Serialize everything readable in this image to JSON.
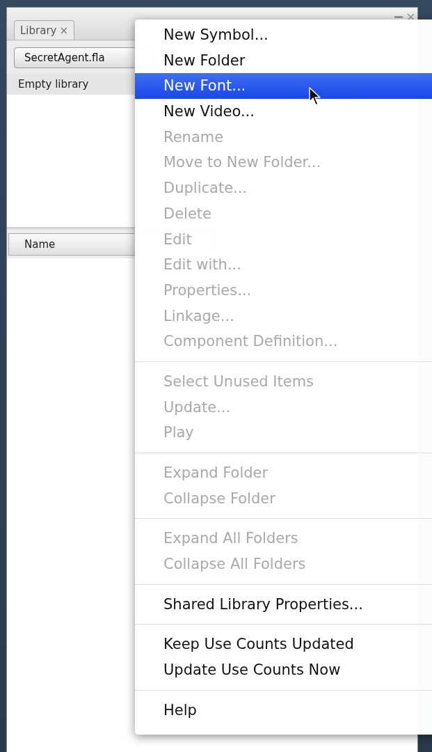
{
  "panel": {
    "tab": {
      "label": "Library",
      "close": "×",
      "selected": true
    },
    "document_dropdown": "SecretAgent.fla",
    "preview_caption": "Empty library",
    "list_columns": [
      "Name"
    ]
  },
  "context_menu": {
    "groups": [
      [
        {
          "label": "New Symbol...",
          "disabled": false,
          "selected": false
        },
        {
          "label": "New Folder",
          "disabled": false,
          "selected": false
        },
        {
          "label": "New Font...",
          "disabled": false,
          "selected": true
        },
        {
          "label": "New Video...",
          "disabled": false,
          "selected": false
        },
        {
          "label": "Rename",
          "disabled": true,
          "selected": false
        },
        {
          "label": "Move to New Folder...",
          "disabled": true,
          "selected": false
        },
        {
          "label": "Duplicate...",
          "disabled": true,
          "selected": false
        },
        {
          "label": "Delete",
          "disabled": true,
          "selected": false
        },
        {
          "label": "Edit",
          "disabled": true,
          "selected": false
        },
        {
          "label": "Edit with...",
          "disabled": true,
          "selected": false
        },
        {
          "label": "Properties...",
          "disabled": true,
          "selected": false
        },
        {
          "label": "Linkage...",
          "disabled": true,
          "selected": false
        },
        {
          "label": "Component Definition...",
          "disabled": true,
          "selected": false
        }
      ],
      [
        {
          "label": "Select Unused Items",
          "disabled": true,
          "selected": false
        },
        {
          "label": "Update...",
          "disabled": true,
          "selected": false
        },
        {
          "label": "Play",
          "disabled": true,
          "selected": false
        }
      ],
      [
        {
          "label": "Expand Folder",
          "disabled": true,
          "selected": false
        },
        {
          "label": "Collapse Folder",
          "disabled": true,
          "selected": false
        }
      ],
      [
        {
          "label": "Expand All Folders",
          "disabled": true,
          "selected": false
        },
        {
          "label": "Collapse All Folders",
          "disabled": true,
          "selected": false
        }
      ],
      [
        {
          "label": "Shared Library Properties...",
          "disabled": false,
          "selected": false
        }
      ],
      [
        {
          "label": "Keep Use Counts Updated",
          "disabled": false,
          "selected": false
        },
        {
          "label": "Update Use Counts Now",
          "disabled": false,
          "selected": false
        }
      ],
      [
        {
          "label": "Help",
          "disabled": false,
          "selected": false
        }
      ]
    ]
  }
}
